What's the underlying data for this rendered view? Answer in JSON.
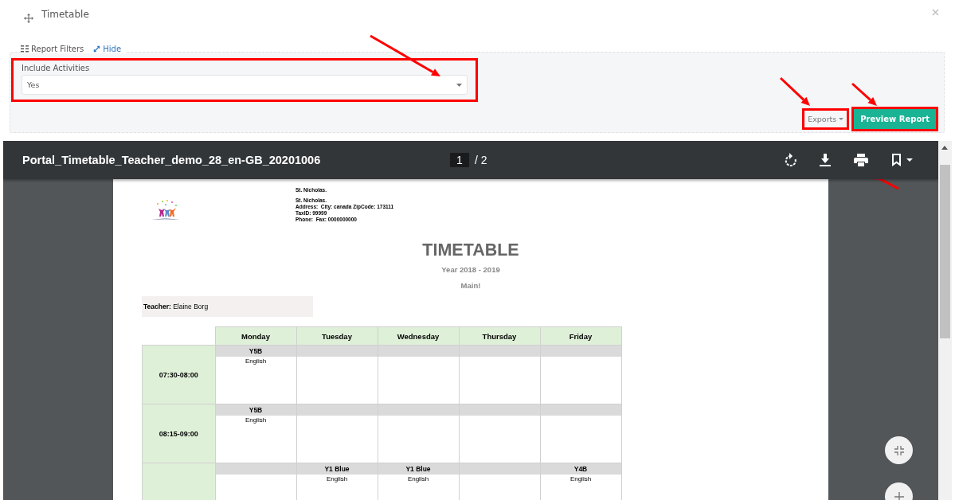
{
  "window": {
    "title": "Timetable"
  },
  "filters": {
    "legend": "Report Filters",
    "hide_link": "Hide",
    "highlighted": true,
    "fields": [
      {
        "label": "Include Activities",
        "value": "Yes"
      }
    ]
  },
  "actions": [
    {
      "kind": "dropdown",
      "label": "Exports",
      "highlighted": true
    },
    {
      "kind": "primary",
      "label": "Preview Report",
      "highlighted": true
    }
  ],
  "viewer": {
    "file_name": "Portal_Timetable_Teacher_demo_28_en-GB_20201006",
    "page": "1",
    "page_count": "/ 2"
  },
  "report": {
    "school_name": "St. Nicholas.",
    "details": [
      "St. Nicholas.",
      "Address:  City: canada ZipCode: 173111",
      "TaxID: 99999",
      "Phone:  Fax: 0000000000"
    ],
    "title": "TIMETABLE",
    "year": "Year 2018 - 2019",
    "subtitle": "Main!",
    "teacher": "**Teacher:** Elaine Borg",
    "days": [
      "Monday",
      "Tuesday",
      "Wednesday",
      "Thursday",
      "Friday"
    ],
    "slots": [
      {
        "time": "07:30-08:00",
        "cells": [
          {
            "class": "Y5B",
            "subject": "English"
          },
          null,
          null,
          null,
          null
        ]
      },
      {
        "time": "08:15-09:00",
        "cells": [
          {
            "class": "Y5B",
            "subject": "English"
          },
          null,
          null,
          null,
          null
        ]
      },
      {
        "cells": [
          null,
          {
            "class": "Y1 Blue",
            "subject": "English"
          },
          {
            "class": "Y1 Blue",
            "subject": "English"
          },
          null,
          {
            "class": "Y4B",
            "subject": "English"
          }
        ]
      }
    ]
  }
}
